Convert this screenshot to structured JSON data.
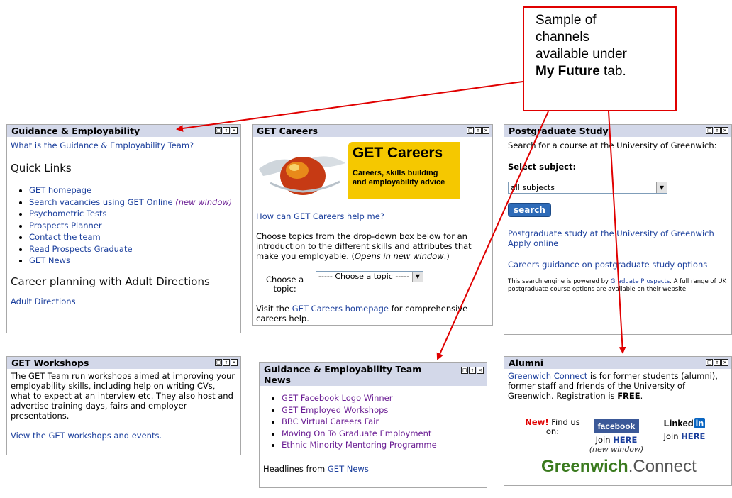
{
  "callout": {
    "line1": "Sample of",
    "line2": "channels",
    "line3": "available under",
    "bold": "My Future",
    "tail": " tab."
  },
  "controls": {
    "min": "□",
    "restore": "⇑",
    "close": "✕"
  },
  "guidance": {
    "title": "Guidance & Employability",
    "link": "What is the Guidance & Employability Team?",
    "quick_heading": "Quick Links",
    "links": [
      "GET homepage",
      "Search vacancies using GET Online",
      "Psychometric Tests",
      "Prospects Planner",
      "Contact the team",
      "Read Prospects Graduate",
      "GET News"
    ],
    "new_window": "(new window)",
    "career_heading": "Career planning with Adult Directions",
    "adult_link": "Adult Directions"
  },
  "get_careers": {
    "title": "GET Careers",
    "banner_title": "GET Careers",
    "banner_sub1": "Careers, skills building",
    "banner_sub2": "and employability advice",
    "help_link": "How can GET Careers help me?",
    "intro": "Choose topics from the drop-down box below for an introduction to the different skills and attributes that make you employable. (",
    "intro_italic": "Opens in new window",
    "intro_end": ".)",
    "choose_label1": "Choose a",
    "choose_label2": "topic:",
    "topic_select": "----- Choose a topic -----",
    "visit_pre": "Visit the ",
    "visit_link": "GET Careers homepage",
    "visit_post": " for comprehensive careers help."
  },
  "postgrad": {
    "title": "Postgraduate Study",
    "intro": "Search for a course at the University of Greenwich:",
    "select_label": "Select subject:",
    "subject_value": "all subjects",
    "search_button": "search",
    "link1": "Postgraduate study at the University of Greenwich",
    "link2": "Apply online",
    "link3": "Careers guidance on postgraduate study options",
    "footer_pre": "This search engine is powered by ",
    "footer_link": "Graduate Prospects",
    "footer_post": ". A full range of UK postgraduate course options are available on their website."
  },
  "workshops": {
    "title": "GET Workshops",
    "text": "The GET Team run workshops aimed at improving your employability skills, including help on writing CVs, what to expect at an interview etc. They also host and advertise training days, fairs and employer presentations.",
    "link": "View the GET workshops and events."
  },
  "news": {
    "title1": "Guidance & Employability Team",
    "title2": "News",
    "items": [
      "GET Facebook Logo Winner",
      "GET Employed Workshops",
      "BBC Virtual Careers Fair",
      "Moving On To Graduate Employment",
      "Ethnic Minority Mentoring Programme"
    ],
    "headlines_pre": "Headlines from ",
    "headlines_link": "GET News"
  },
  "alumni": {
    "title": "Alumni",
    "link": "Greenwich Connect",
    "text": " is for former students (alumni), former staff and friends of the University of Greenwich. Registration is ",
    "free": "FREE",
    "text_end": ".",
    "new": "New!",
    "find_us": " Find us on:",
    "facebook": "facebook",
    "join": "Join ",
    "here": "HERE",
    "new_window": "(new window)",
    "linked": "Linked",
    "in": "in",
    "connect_a": "Greenwich",
    "connect_b": ".Connect"
  },
  "colors": {
    "header_bg": "#d3d8e9",
    "link": "#1a3e9c",
    "visited": "#6b1e94",
    "callout_border": "#e00000",
    "banner_yellow": "#f5c800",
    "facebook": "#3b5998"
  }
}
